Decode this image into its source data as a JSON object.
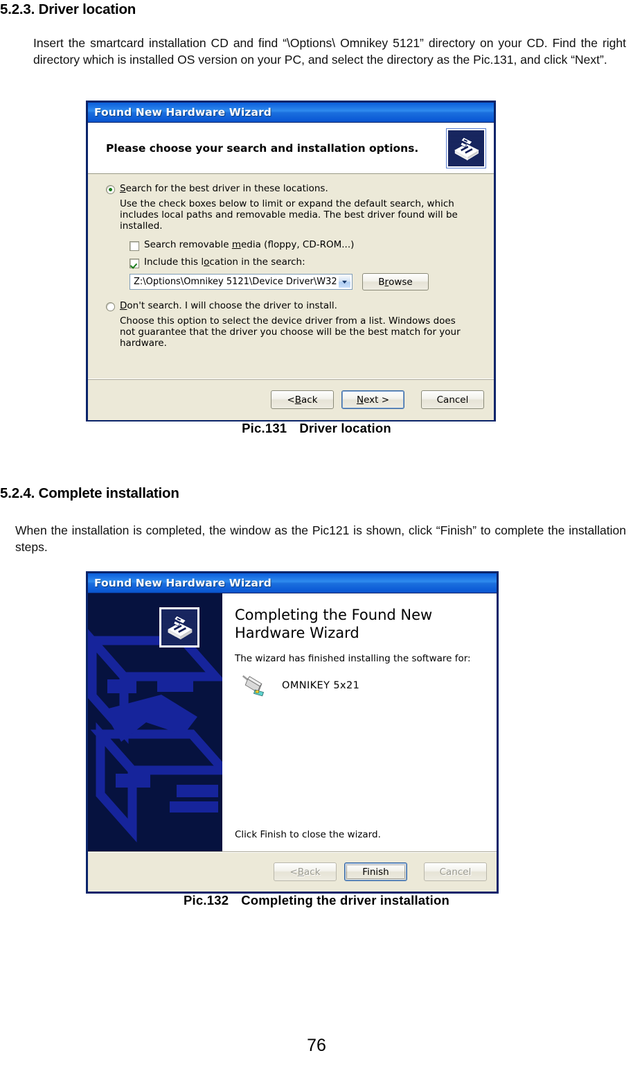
{
  "document": {
    "section1": {
      "heading": "5.2.3. Driver location",
      "paragraph": "Insert the smartcard installation CD and find “\\Options\\ Omnikey 5121” directory on your CD. Find the right directory which is installed OS version on your PC, and select the directory as the Pic.131, and click “Next”.",
      "caption_label": "Pic.131",
      "caption_text": "Driver location"
    },
    "section2": {
      "heading": "5.2.4. Complete installation",
      "paragraph": "When the installation is completed, the window as the Pic121 is shown, click “Finish” to complete the installation steps.",
      "caption_label": "Pic.132",
      "caption_text": "Completing the driver installation"
    },
    "page_number": "76"
  },
  "dialog1": {
    "title": "Found New Hardware Wizard",
    "header_text": "Please choose your search and installation options.",
    "option_search": {
      "label_pre": "",
      "label_underline": "S",
      "label_post": "earch for the best driver in these locations.",
      "checked": true
    },
    "option_search_desc": "Use the check boxes below to limit or expand the default search, which includes local paths and removable media. The best driver found will be installed.",
    "check_removable": {
      "pre": "Search removable ",
      "underline": "m",
      "post": "edia (floppy, CD-ROM...)",
      "checked": false
    },
    "check_include": {
      "pre": "Include this l",
      "underline": "o",
      "post": "cation in the search:",
      "checked": true
    },
    "path_value": "Z:\\Options\\Omnikey 5121\\Device Driver\\W32",
    "browse_button": {
      "pre": "B",
      "underline": "r",
      "post": "owse"
    },
    "option_dont_search": {
      "pre": "",
      "underline": "D",
      "post": "on't search. I will choose the driver to install.",
      "checked": false
    },
    "option_dont_search_desc": "Choose this option to select the device driver from a list.  Windows does not guarantee that the driver you choose will be the best match for your hardware.",
    "buttons": {
      "back": {
        "pre": "< ",
        "underline": "B",
        "post": "ack"
      },
      "next": {
        "pre": "",
        "underline": "N",
        "post": "ext >"
      },
      "cancel": {
        "pre": "Cancel",
        "underline": "",
        "post": ""
      }
    }
  },
  "dialog2": {
    "title": "Found New Hardware Wizard",
    "heading_line1": "Completing the Found New",
    "heading_line2": "Hardware Wizard",
    "subtitle": "The wizard has finished installing the software for:",
    "device_name": "OMNIKEY 5x21",
    "footer_note": "Click Finish to close the wizard.",
    "buttons": {
      "back": {
        "pre": "< ",
        "underline": "B",
        "post": "ack"
      },
      "finish": {
        "pre": "Finish",
        "underline": "",
        "post": ""
      },
      "cancel": {
        "pre": "Cancel",
        "underline": "",
        "post": ""
      }
    }
  },
  "colors": {
    "titlebar_blue": "#0B5ED9",
    "dialog_face": "#ECE9D8",
    "dialog_border": "#0A246A",
    "panel_navy": "#06123F",
    "check_green": "#1A7D1A"
  }
}
